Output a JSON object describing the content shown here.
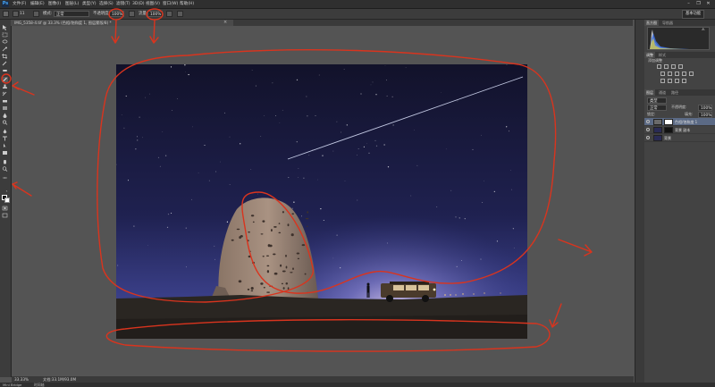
{
  "app": {
    "logo": "Ps"
  },
  "menu": [
    "文件(F)",
    "编辑(E)",
    "图像(I)",
    "图层(L)",
    "类型(Y)",
    "选择(S)",
    "滤镜(T)",
    "3D(D)",
    "视图(V)",
    "窗口(W)",
    "帮助(H)"
  ],
  "window_controls": [
    "–",
    "❐",
    "✕"
  ],
  "options": {
    "size_value": "11",
    "mode_label": "模式:",
    "mode_value": "正常",
    "opacity_label": "不透明度:",
    "opacity_value": "100%",
    "flow_label": "流量:",
    "flow_value": "100%"
  },
  "workspace": "基本功能",
  "document": {
    "tab_title": "IMG_5358-4.tif @ 33.3% (色相/饱和度 1, 图层蒙版/8) *",
    "close": "×",
    "zoom": "33.33%",
    "doc_info": "文档:33.1M/93.0M"
  },
  "bottom": {
    "mini_bridge": "Mini Bridge",
    "timeline": "时间轴"
  },
  "histogram_panel": {
    "tabs": [
      "直方图",
      "导航器"
    ],
    "warning": "⚠"
  },
  "adjustments_panel": {
    "tabs": [
      "调整",
      "样式"
    ],
    "title": "添加调整"
  },
  "layers_panel": {
    "tabs": [
      "图层",
      "通道",
      "路径"
    ],
    "kind_label": "类型",
    "blend_mode": "正常",
    "opacity_label": "不透明度:",
    "opacity_value": "100%",
    "lock_label": "锁定:",
    "fill_label": "填充:",
    "fill_value": "100%",
    "layers": [
      {
        "name": "色相/饱和度 1",
        "selected": true
      },
      {
        "name": "背景 副本",
        "selected": false
      },
      {
        "name": "背景",
        "selected": false
      }
    ]
  },
  "colors": {
    "annotation": "#d9341e",
    "selection": "#5b6a85"
  }
}
